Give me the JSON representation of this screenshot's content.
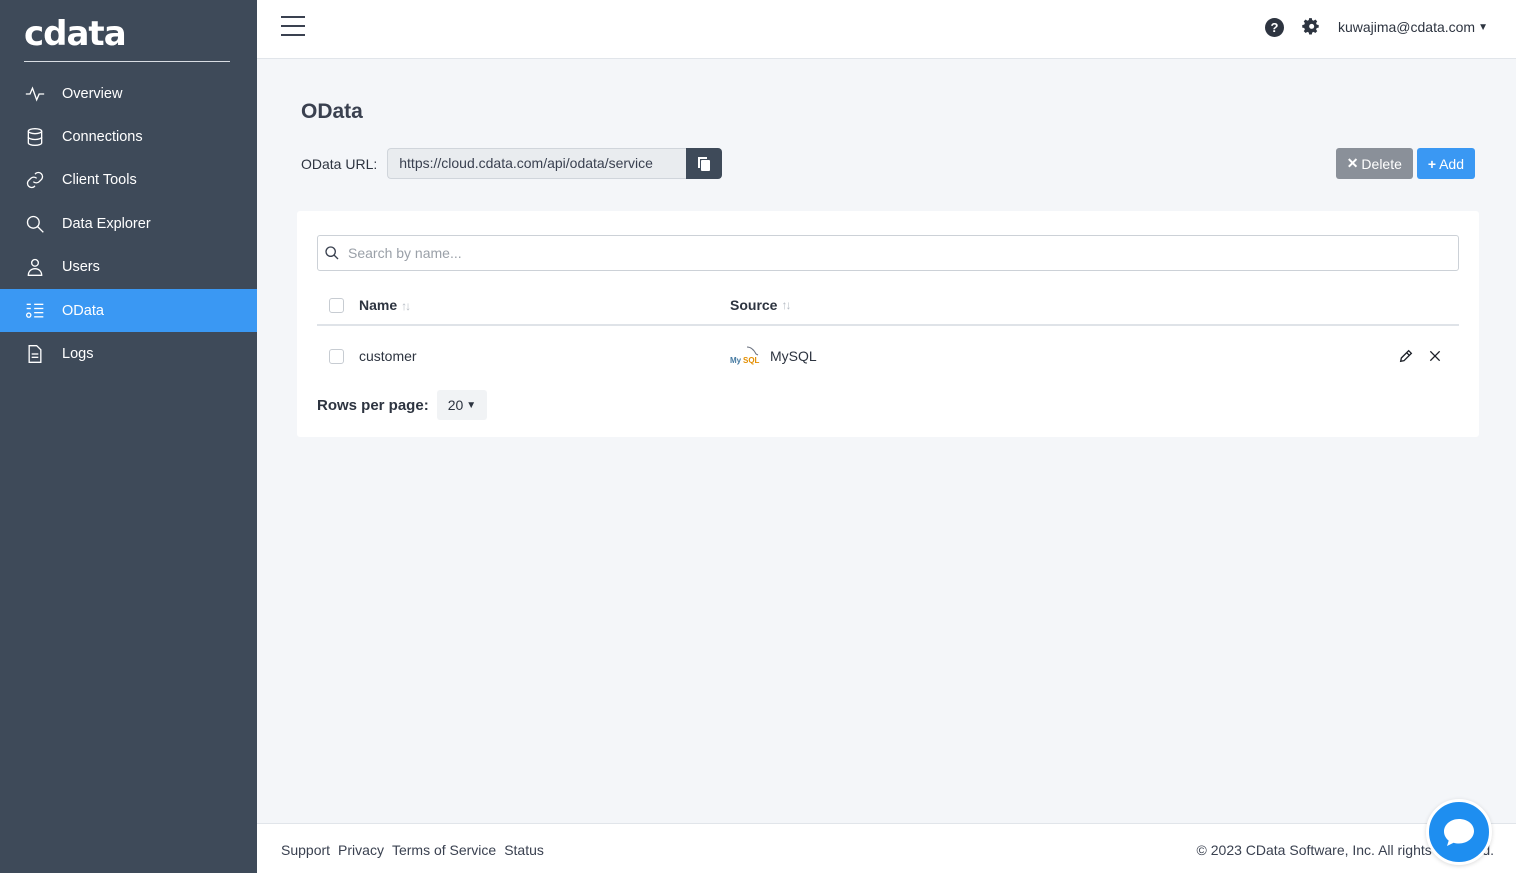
{
  "brand": {
    "logo_text": "cdata"
  },
  "sidebar": {
    "items": [
      {
        "label": "Overview",
        "icon": "activity-icon"
      },
      {
        "label": "Connections",
        "icon": "database-icon"
      },
      {
        "label": "Client Tools",
        "icon": "link-icon"
      },
      {
        "label": "Data Explorer",
        "icon": "search-icon"
      },
      {
        "label": "Users",
        "icon": "user-icon"
      },
      {
        "label": "OData",
        "icon": "odata-icon",
        "active": true
      },
      {
        "label": "Logs",
        "icon": "document-icon"
      }
    ]
  },
  "topbar": {
    "help_glyph": "?",
    "user_email": "kuwajima@cdata.com"
  },
  "page": {
    "title": "OData",
    "url_label": "OData URL:",
    "url_value": "https://cloud.cdata.com/api/odata/service",
    "delete_label": "Delete",
    "add_label": "Add"
  },
  "table": {
    "search_placeholder": "Search by name...",
    "columns": {
      "name": "Name",
      "source": "Source"
    },
    "sort_glyph": "↑↓",
    "rows": [
      {
        "name": "customer",
        "source": "MySQL",
        "source_logo_my": "My",
        "source_logo_sql": "SQL"
      }
    ],
    "rows_per_page_label": "Rows per page:",
    "rows_per_page_value": "20"
  },
  "footer": {
    "links": [
      "Support",
      "Privacy",
      "Terms of Service",
      "Status"
    ],
    "copyright": "© 2023 CData Software, Inc. All rights reserved."
  },
  "colors": {
    "sidebar_bg": "#3e4a59",
    "accent": "#3a98f3",
    "delete_btn": "#8a9099",
    "chat_btn": "#1e8ef0"
  }
}
